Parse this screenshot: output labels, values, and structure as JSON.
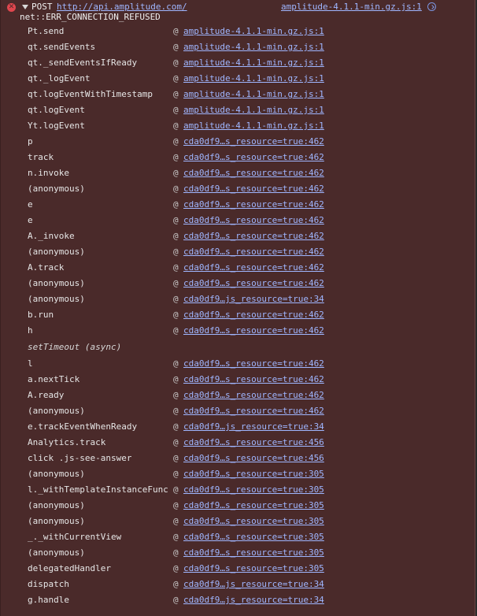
{
  "header": {
    "error_icon": "error-circle-x-icon",
    "method": "POST",
    "url": "http://api.amplitude.com/",
    "source": "amplitude-4.1.1-min.gz.js:1",
    "reveal_icon": "reveal-source-icon",
    "message": "net::ERR_CONNECTION_REFUSED"
  },
  "at_symbol": "@",
  "frames": [
    {
      "fn": "Pt.send",
      "loc": "amplitude-4.1.1-min.gz.js:1"
    },
    {
      "fn": "qt.sendEvents",
      "loc": "amplitude-4.1.1-min.gz.js:1"
    },
    {
      "fn": "qt._sendEventsIfReady",
      "loc": "amplitude-4.1.1-min.gz.js:1"
    },
    {
      "fn": "qt._logEvent",
      "loc": "amplitude-4.1.1-min.gz.js:1"
    },
    {
      "fn": "qt.logEventWithTimestamp",
      "loc": "amplitude-4.1.1-min.gz.js:1"
    },
    {
      "fn": "qt.logEvent",
      "loc": "amplitude-4.1.1-min.gz.js:1"
    },
    {
      "fn": "Yt.logEvent",
      "loc": "amplitude-4.1.1-min.gz.js:1"
    },
    {
      "fn": "p",
      "loc": "cda0df9…s_resource=true:462"
    },
    {
      "fn": "track",
      "loc": "cda0df9…s_resource=true:462"
    },
    {
      "fn": "n.invoke",
      "loc": "cda0df9…s_resource=true:462"
    },
    {
      "fn": "(anonymous)",
      "loc": "cda0df9…s_resource=true:462"
    },
    {
      "fn": "e",
      "loc": "cda0df9…s_resource=true:462"
    },
    {
      "fn": "e",
      "loc": "cda0df9…s_resource=true:462"
    },
    {
      "fn": "A._invoke",
      "loc": "cda0df9…s_resource=true:462"
    },
    {
      "fn": "(anonymous)",
      "loc": "cda0df9…s_resource=true:462"
    },
    {
      "fn": "A.track",
      "loc": "cda0df9…s_resource=true:462"
    },
    {
      "fn": "(anonymous)",
      "loc": "cda0df9…s_resource=true:462"
    },
    {
      "fn": "(anonymous)",
      "loc": "cda0df9…js_resource=true:34"
    },
    {
      "fn": "b.run",
      "loc": "cda0df9…s_resource=true:462"
    },
    {
      "fn": "h",
      "loc": "cda0df9…s_resource=true:462"
    },
    {
      "async": true,
      "fn": "setTimeout (async)"
    },
    {
      "fn": "l",
      "loc": "cda0df9…s_resource=true:462"
    },
    {
      "fn": "a.nextTick",
      "loc": "cda0df9…s_resource=true:462"
    },
    {
      "fn": "A.ready",
      "loc": "cda0df9…s_resource=true:462"
    },
    {
      "fn": "(anonymous)",
      "loc": "cda0df9…s_resource=true:462"
    },
    {
      "fn": "e.trackEventWhenReady",
      "loc": "cda0df9…js_resource=true:34"
    },
    {
      "fn": "Analytics.track",
      "loc": "cda0df9…s_resource=true:456"
    },
    {
      "fn": "click .js-see-answer",
      "loc": "cda0df9…s_resource=true:456"
    },
    {
      "fn": "(anonymous)",
      "loc": "cda0df9…s_resource=true:305"
    },
    {
      "fn": "l._withTemplateInstanceFunc",
      "loc": "cda0df9…s_resource=true:305"
    },
    {
      "fn": "(anonymous)",
      "loc": "cda0df9…s_resource=true:305"
    },
    {
      "fn": "(anonymous)",
      "loc": "cda0df9…s_resource=true:305"
    },
    {
      "fn": "_._withCurrentView",
      "loc": "cda0df9…s_resource=true:305"
    },
    {
      "fn": "(anonymous)",
      "loc": "cda0df9…s_resource=true:305"
    },
    {
      "fn": "delegatedHandler",
      "loc": "cda0df9…s_resource=true:305"
    },
    {
      "fn": "dispatch",
      "loc": "cda0df9…js_resource=true:34"
    },
    {
      "fn": "g.handle",
      "loc": "cda0df9…js_resource=true:34"
    }
  ]
}
